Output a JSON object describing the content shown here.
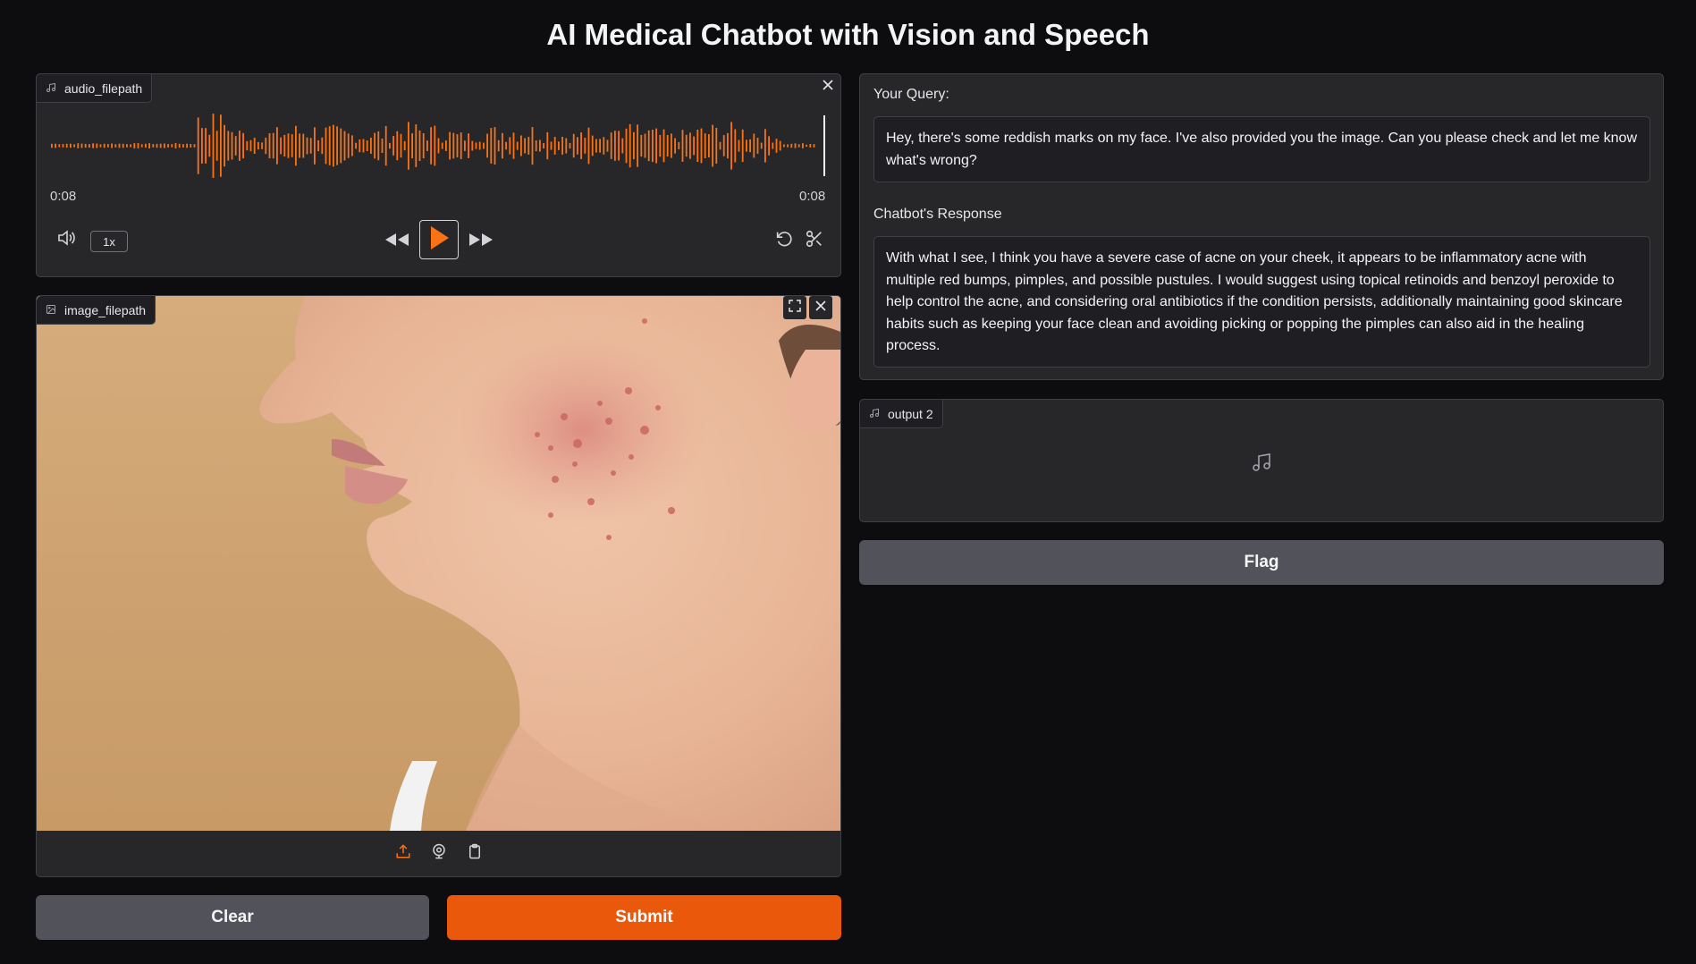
{
  "app": {
    "title": "AI Medical Chatbot with Vision and Speech"
  },
  "audio_input": {
    "label": "audio_filepath",
    "current_time": "0:08",
    "duration": "0:08",
    "playback_speed": "1x",
    "accent_color": "#f97316"
  },
  "image_input": {
    "label": "image_filepath",
    "image_description": "close-up photo of a woman's cheek and jaw with acne",
    "source_icons": [
      "upload-icon",
      "webcam-icon",
      "clipboard-icon"
    ]
  },
  "query": {
    "label": "Your Query:",
    "value": " Hey, there's some reddish marks on my face. I've also provided you the image. Can you please check and let me know what's wrong?"
  },
  "response": {
    "label": "Chatbot's Response",
    "value": "With what I see, I think you have a severe case of acne on your cheek, it appears to be inflammatory acne with multiple red bumps, pimples, and possible pustules. I would suggest using topical retinoids and benzoyl peroxide to help control the acne, and considering oral antibiotics if the condition persists, additionally maintaining good skincare habits such as keeping your face clean and avoiding picking or popping the pimples can also aid in the healing process."
  },
  "audio_output": {
    "label": "output 2"
  },
  "buttons": {
    "flag": "Flag",
    "clear": "Clear",
    "submit": "Submit"
  },
  "colors": {
    "background": "#0d0d10",
    "panel": "#27272a",
    "primary": "#ea580c",
    "secondary": "#52525b"
  }
}
